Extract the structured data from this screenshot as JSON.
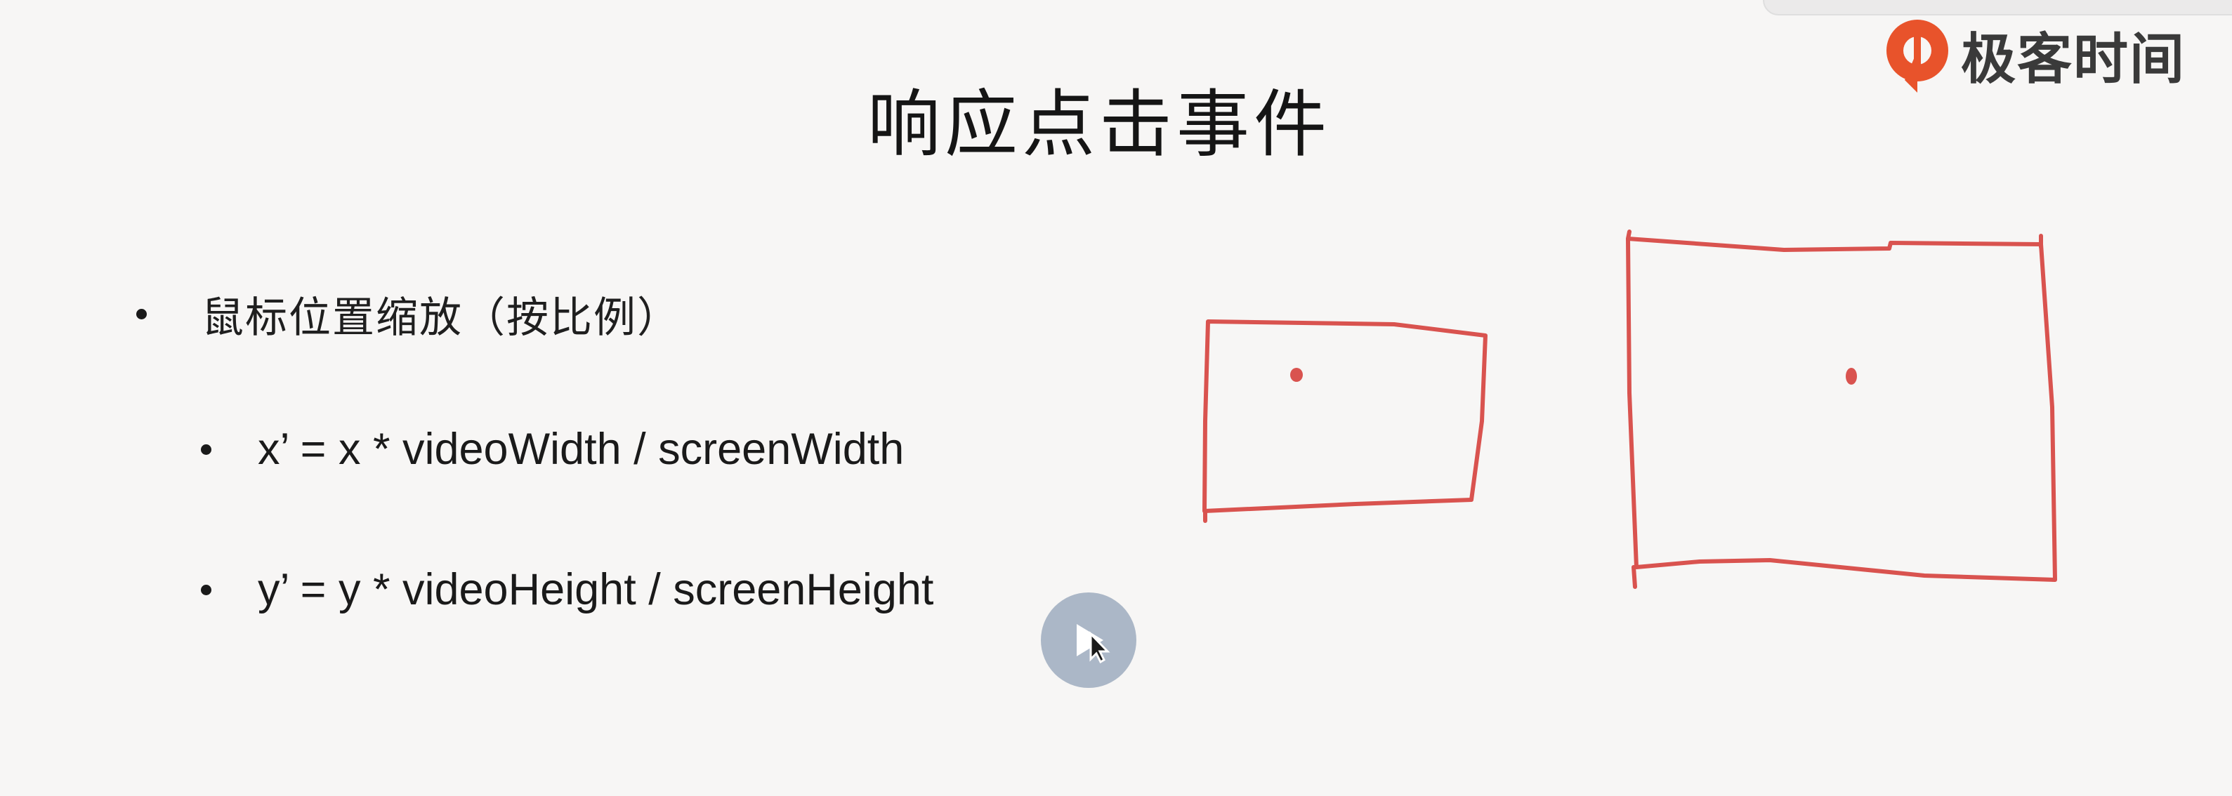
{
  "brand": {
    "name": "极客时间",
    "accent": "#e8532b"
  },
  "slide": {
    "title": "响应点击事件",
    "bullets": [
      "鼠标位置缩放（按比例）",
      "x’ = x * videoWidth /  screenWidth",
      "y’ = y * videoHeight / screenHeight"
    ]
  },
  "drawing": {
    "stroke_color": "#d9534f"
  },
  "player": {
    "play_icon": "play-icon",
    "cursor_icon": "cursor-icon"
  }
}
